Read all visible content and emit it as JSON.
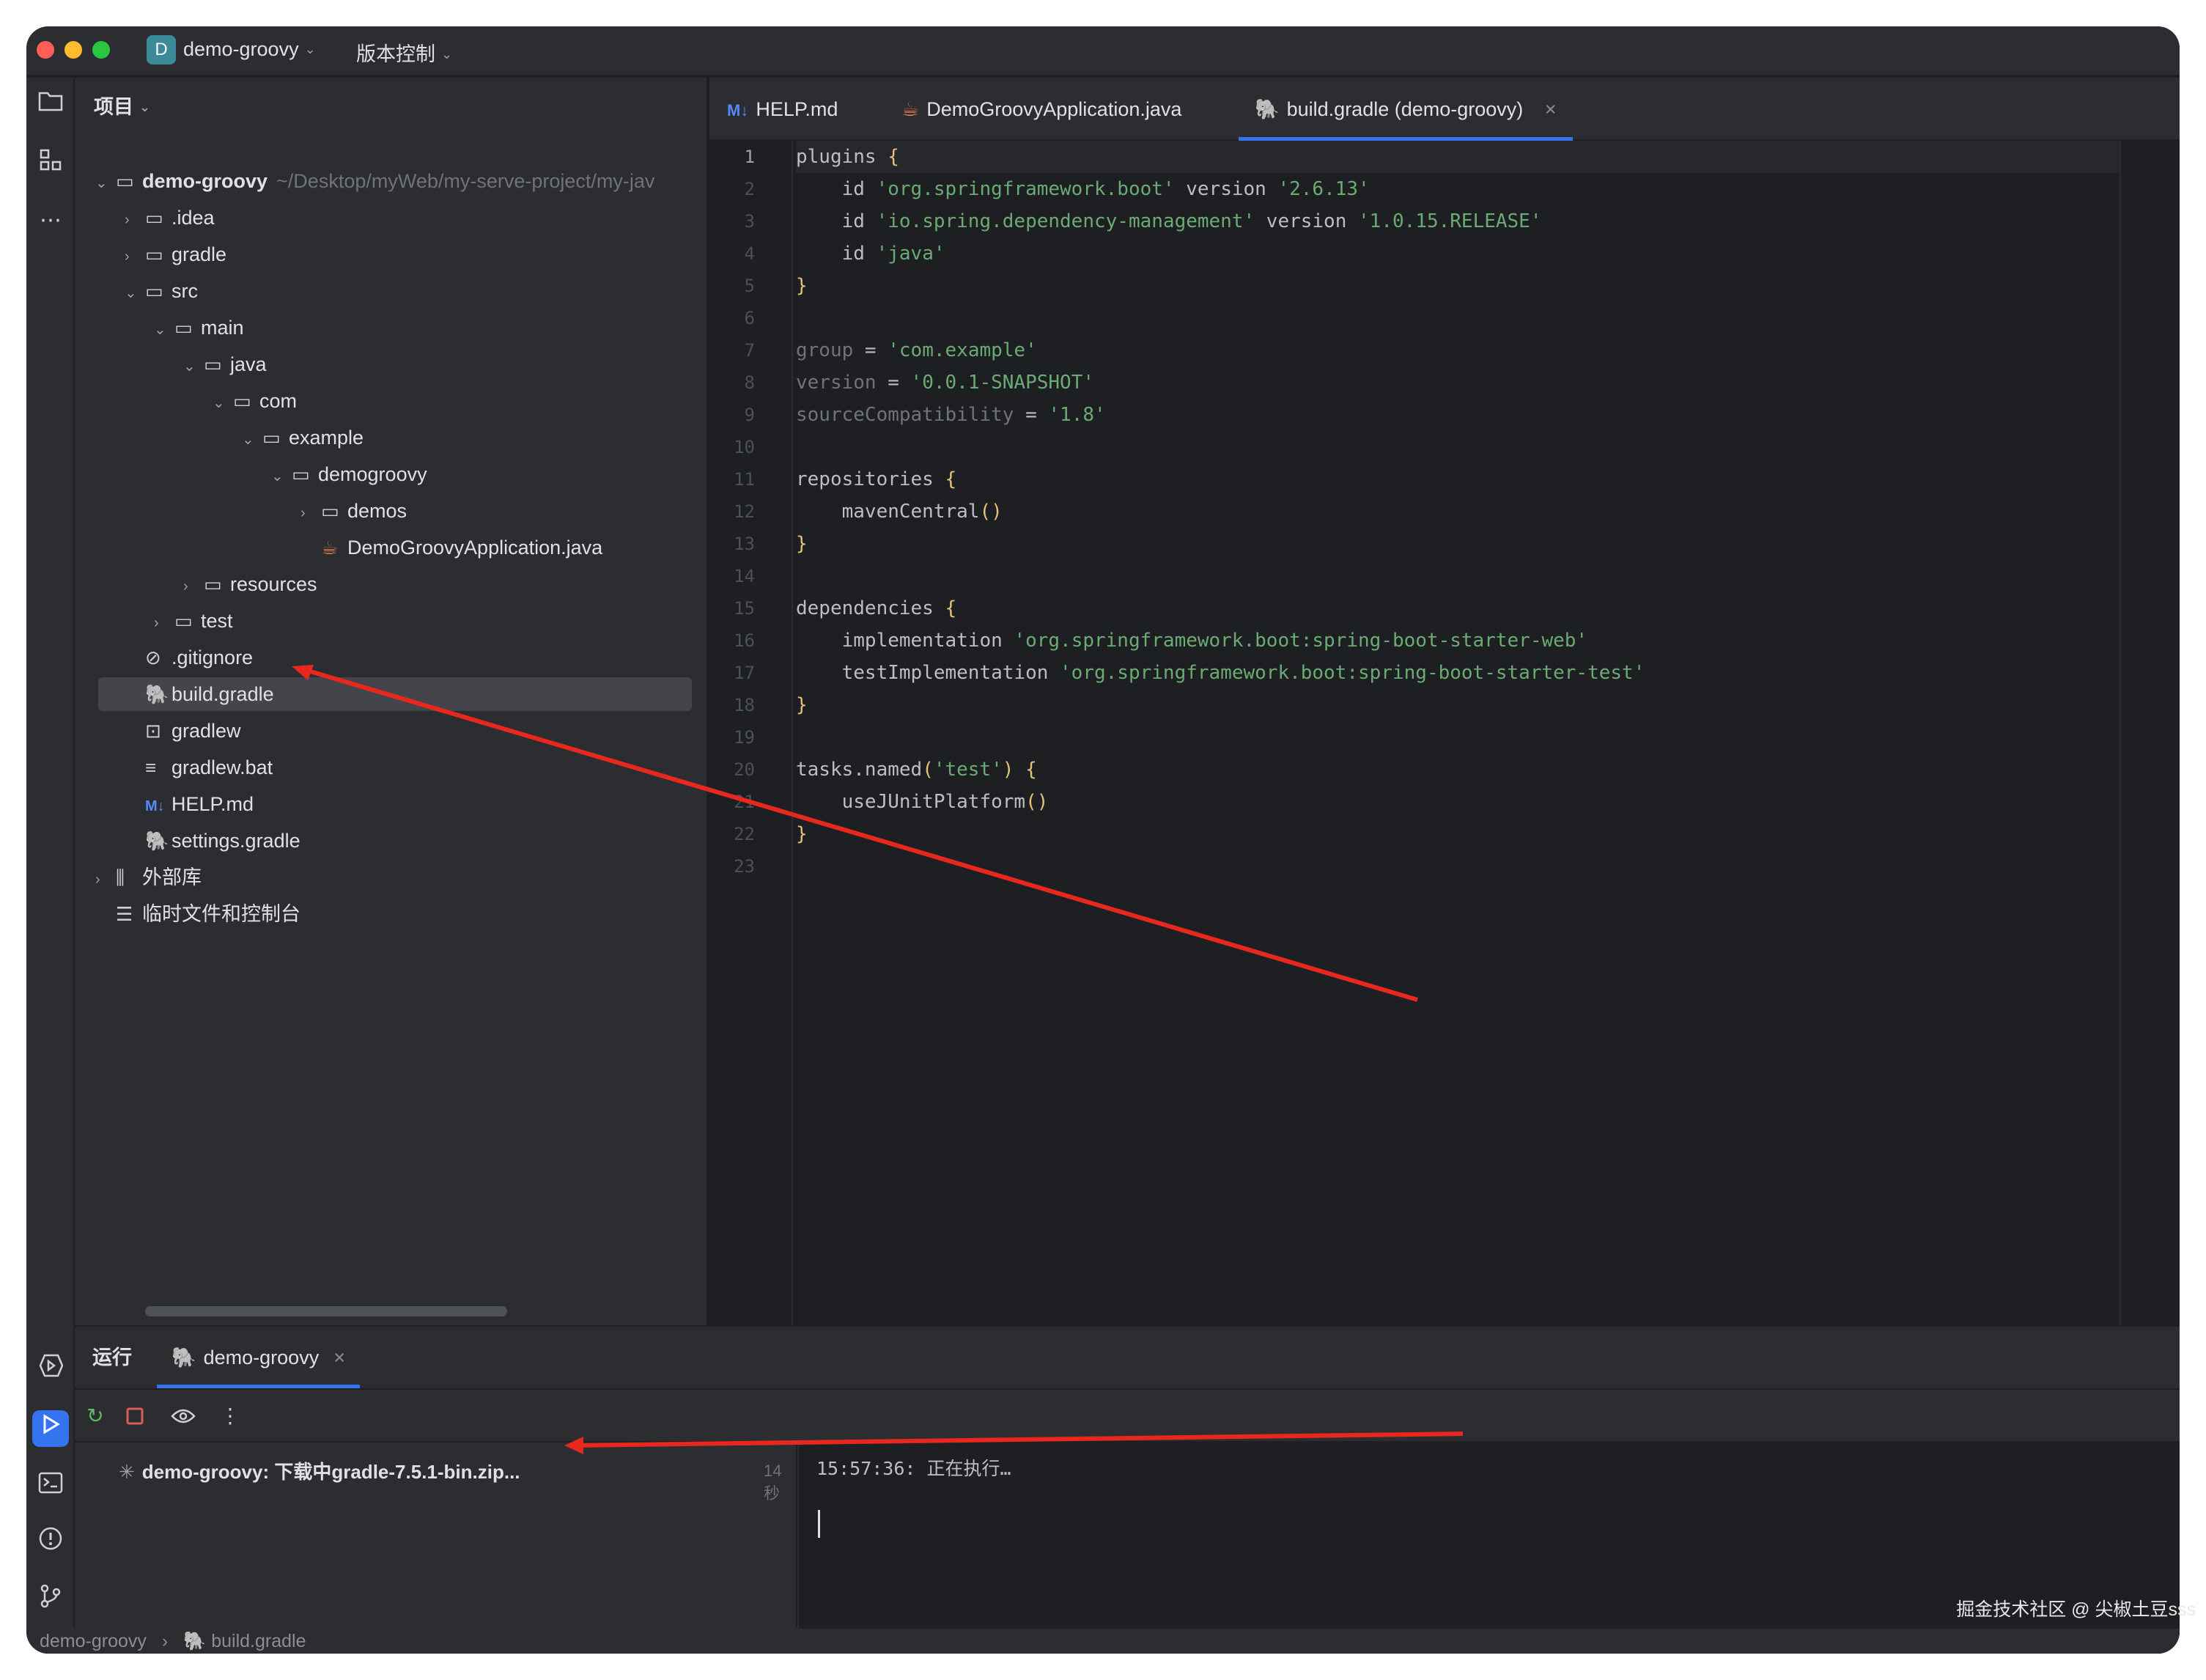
{
  "titlebar": {
    "project_badge": "D",
    "project_name": "demo-groovy",
    "vcs_menu": "版本控制"
  },
  "project_panel": {
    "header": "项目",
    "tree": [
      {
        "label": "demo-groovy",
        "path": "~/Desktop/myWeb/my-serve-project/my-jav",
        "icon": "module-folder-icon",
        "expanded": true
      },
      {
        "label": ".idea",
        "icon": "folder-icon",
        "expanded": false
      },
      {
        "label": "gradle",
        "icon": "folder-icon",
        "expanded": false
      },
      {
        "label": "src",
        "icon": "folder-icon",
        "expanded": true
      },
      {
        "label": "main",
        "icon": "folder-icon",
        "expanded": true
      },
      {
        "label": "java",
        "icon": "folder-icon",
        "expanded": true
      },
      {
        "label": "com",
        "icon": "folder-icon",
        "expanded": true
      },
      {
        "label": "example",
        "icon": "folder-icon",
        "expanded": true
      },
      {
        "label": "demogroovy",
        "icon": "folder-icon",
        "expanded": true
      },
      {
        "label": "demos",
        "icon": "folder-icon",
        "expanded": false
      },
      {
        "label": "DemoGroovyApplication.java",
        "icon": "java-file-icon"
      },
      {
        "label": "resources",
        "icon": "folder-icon",
        "expanded": false
      },
      {
        "label": "test",
        "icon": "folder-icon",
        "expanded": false
      },
      {
        "label": ".gitignore",
        "icon": "ignore-file-icon"
      },
      {
        "label": "build.gradle",
        "icon": "gradle-file-icon",
        "selected": true
      },
      {
        "label": "gradlew",
        "icon": "terminal-file-icon"
      },
      {
        "label": "gradlew.bat",
        "icon": "text-file-icon"
      },
      {
        "label": "HELP.md",
        "icon": "markdown-file-icon"
      },
      {
        "label": "settings.gradle",
        "icon": "gradle-file-icon"
      },
      {
        "label": "外部库",
        "icon": "library-icon",
        "expanded": false
      },
      {
        "label": "临时文件和控制台",
        "icon": "scratch-icon"
      }
    ]
  },
  "editor": {
    "tabs": [
      {
        "label": "HELP.md",
        "icon": "M↓"
      },
      {
        "label": "DemoGroovyApplication.java",
        "icon": "java-file-icon"
      },
      {
        "label": "build.gradle (demo-groovy)",
        "icon": "gradle-file-icon",
        "active": true
      }
    ],
    "lines": [
      "plugins {",
      "    id 'org.springframework.boot' version '2.6.13'",
      "    id 'io.spring.dependency-management' version '1.0.15.RELEASE'",
      "    id 'java'",
      "}",
      "",
      "group = 'com.example'",
      "version = '0.0.1-SNAPSHOT'",
      "sourceCompatibility = '1.8'",
      "",
      "repositories {",
      "    mavenCentral()",
      "}",
      "",
      "dependencies {",
      "    implementation 'org.springframework.boot:spring-boot-starter-web'",
      "    testImplementation 'org.springframework.boot:spring-boot-starter-test'",
      "}",
      "",
      "tasks.named('test') {",
      "    useJUnitPlatform()",
      "}",
      ""
    ],
    "current_line": 1
  },
  "run_panel": {
    "label": "运行",
    "tab": "demo-groovy",
    "task": "demo-groovy: 下载中gradle-7.5.1-bin.zip...",
    "elapsed": "14秒",
    "console_line": "15:57:36: 正在执行…"
  },
  "statusbar": {
    "crumb_project": "demo-groovy",
    "crumb_file": "build.gradle"
  },
  "watermark": "掘金技术社区 @ 尖椒土豆sss",
  "colors": {
    "accent": "#3574f0",
    "annotation_arrow": "#e8281f",
    "string": "#6aab73",
    "brace": "#e5c07b"
  }
}
